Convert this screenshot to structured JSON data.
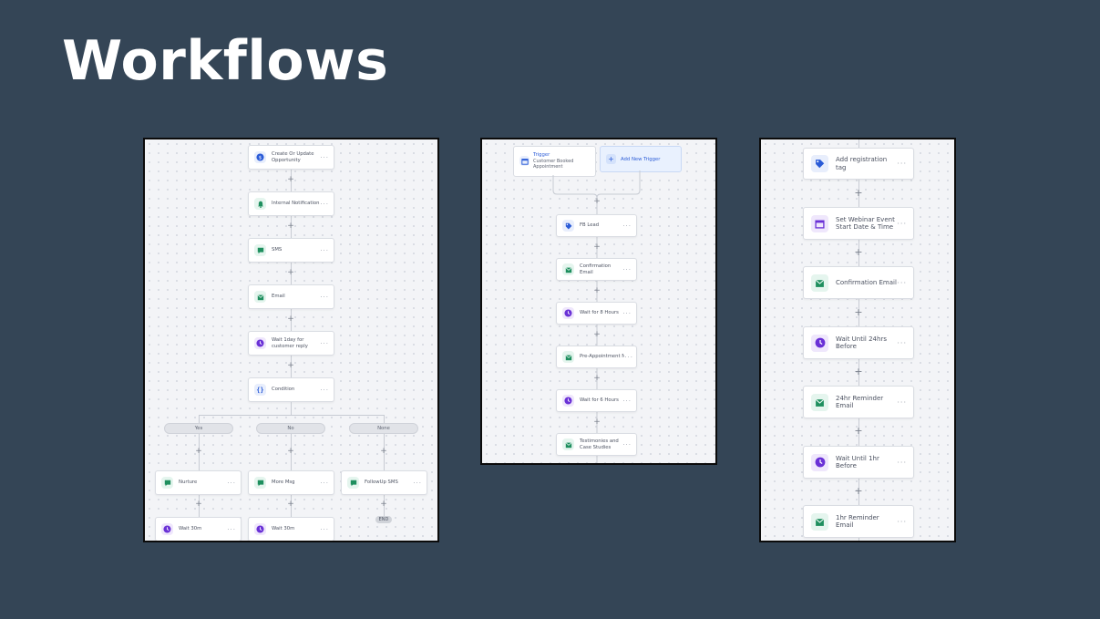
{
  "page": {
    "title": "Workflows"
  },
  "colors": {
    "background": "#344556",
    "green": "#1e8f5e",
    "purple": "#6a31d6",
    "blue": "#2a5bd7"
  },
  "workflow1": {
    "steps": [
      {
        "label": "Create Or Update Opportunity",
        "icon": "opportunity-icon"
      },
      {
        "label": "Internal Notification",
        "icon": "bell-icon"
      },
      {
        "label": "SMS",
        "icon": "sms-icon"
      },
      {
        "label": "Email",
        "icon": "email-icon"
      },
      {
        "label": "Wait 1day for customer reply",
        "icon": "clock-icon"
      },
      {
        "label": "Condition",
        "icon": "braces-icon"
      }
    ],
    "branches": [
      {
        "label": "Yes",
        "steps": [
          {
            "label": "Nurture",
            "icon": "sms-icon"
          },
          {
            "label": "Wait 30m",
            "icon": "clock-icon"
          }
        ]
      },
      {
        "label": "No",
        "steps": [
          {
            "label": "More Msg",
            "icon": "sms-icon"
          },
          {
            "label": "Wait 30m",
            "icon": "clock-icon"
          }
        ]
      },
      {
        "label": "None",
        "steps": [
          {
            "label": "FollowUp SMS",
            "icon": "sms-icon"
          }
        ],
        "end": "END"
      }
    ]
  },
  "workflow2": {
    "trigger": {
      "title": "Trigger",
      "subtitle": "Customer Booked Appointment",
      "icon": "calendar-icon"
    },
    "add_trigger": "Add New Trigger",
    "steps": [
      {
        "label": "FB Lead",
        "icon": "tag-icon"
      },
      {
        "label": "Confirmation Email",
        "icon": "email-icon"
      },
      {
        "label": "Wait for 8 Hours",
        "icon": "clock-icon"
      },
      {
        "label": "Pre-Appointment Nurturing",
        "icon": "email-icon"
      },
      {
        "label": "Wait for 6 Hours",
        "icon": "clock-icon"
      },
      {
        "label": "Testimonies and Case Studies",
        "icon": "email-icon"
      }
    ]
  },
  "workflow3": {
    "steps": [
      {
        "label": "Add registration tag",
        "icon": "tag-icon"
      },
      {
        "label": "Set Webinar Event Start Date & Time",
        "icon": "calendar-icon"
      },
      {
        "label": "Confirmation Email",
        "icon": "email-icon"
      },
      {
        "label": "Wait Until 24hrs Before",
        "icon": "clock-icon"
      },
      {
        "label": "24hr Reminder Email",
        "icon": "email-icon"
      },
      {
        "label": "Wait Until 1hr Before",
        "icon": "clock-icon"
      },
      {
        "label": "1hr Reminder Email",
        "icon": "email-icon"
      }
    ]
  },
  "menu_glyph": "···",
  "plus_glyph": "+"
}
